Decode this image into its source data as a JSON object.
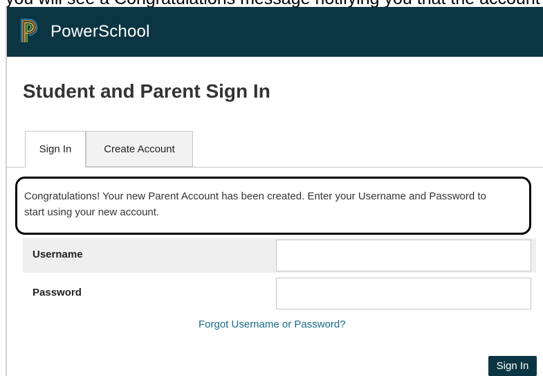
{
  "top_fragment": "you will see a Congratulations message notifying you that the account has been created. You may now log in to your account.",
  "header": {
    "brand": "PowerSchool",
    "logo_icon": "powerschool-p-logo-icon",
    "background_color": "#0c3543",
    "logo_colors": [
      "#e87722",
      "#f2c14e",
      "#7dbb42",
      "#29a8e0"
    ]
  },
  "page_title": "Student and Parent Sign In",
  "tabs": [
    {
      "label": "Sign In",
      "active": true
    },
    {
      "label": "Create Account",
      "active": false
    }
  ],
  "message": {
    "text": "Congratulations! Your new Parent Account has been created. Enter your Username and Password to start using your new account."
  },
  "form": {
    "username_label": "Username",
    "username_value": "",
    "password_label": "Password",
    "password_value": "",
    "forgot_link": "Forgot Username or Password?",
    "submit_label": "Sign In"
  }
}
